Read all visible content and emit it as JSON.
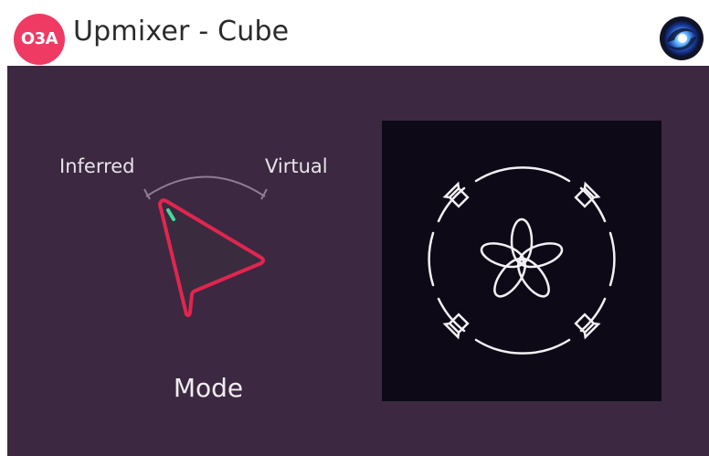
{
  "header": {
    "brand_badge": "O3A",
    "title": "Upmixer - Cube",
    "vendor_logo_icon": "swirl-logo-icon"
  },
  "controls": {
    "mode_knob": {
      "caption": "Mode",
      "min_label": "Inferred",
      "max_label": "Virtual",
      "value_fraction": 0.0
    }
  },
  "display": {
    "icon": "cube-speaker-layout-icon",
    "speaker_icon": "speaker-icon",
    "source_icon": "flower-source-icon"
  },
  "colors": {
    "panel_background": "#3c2840",
    "display_background": "#0d0917",
    "accent": "#ef3a63",
    "knob_outline": "#e0264f",
    "indicator": "#47d6a0"
  }
}
